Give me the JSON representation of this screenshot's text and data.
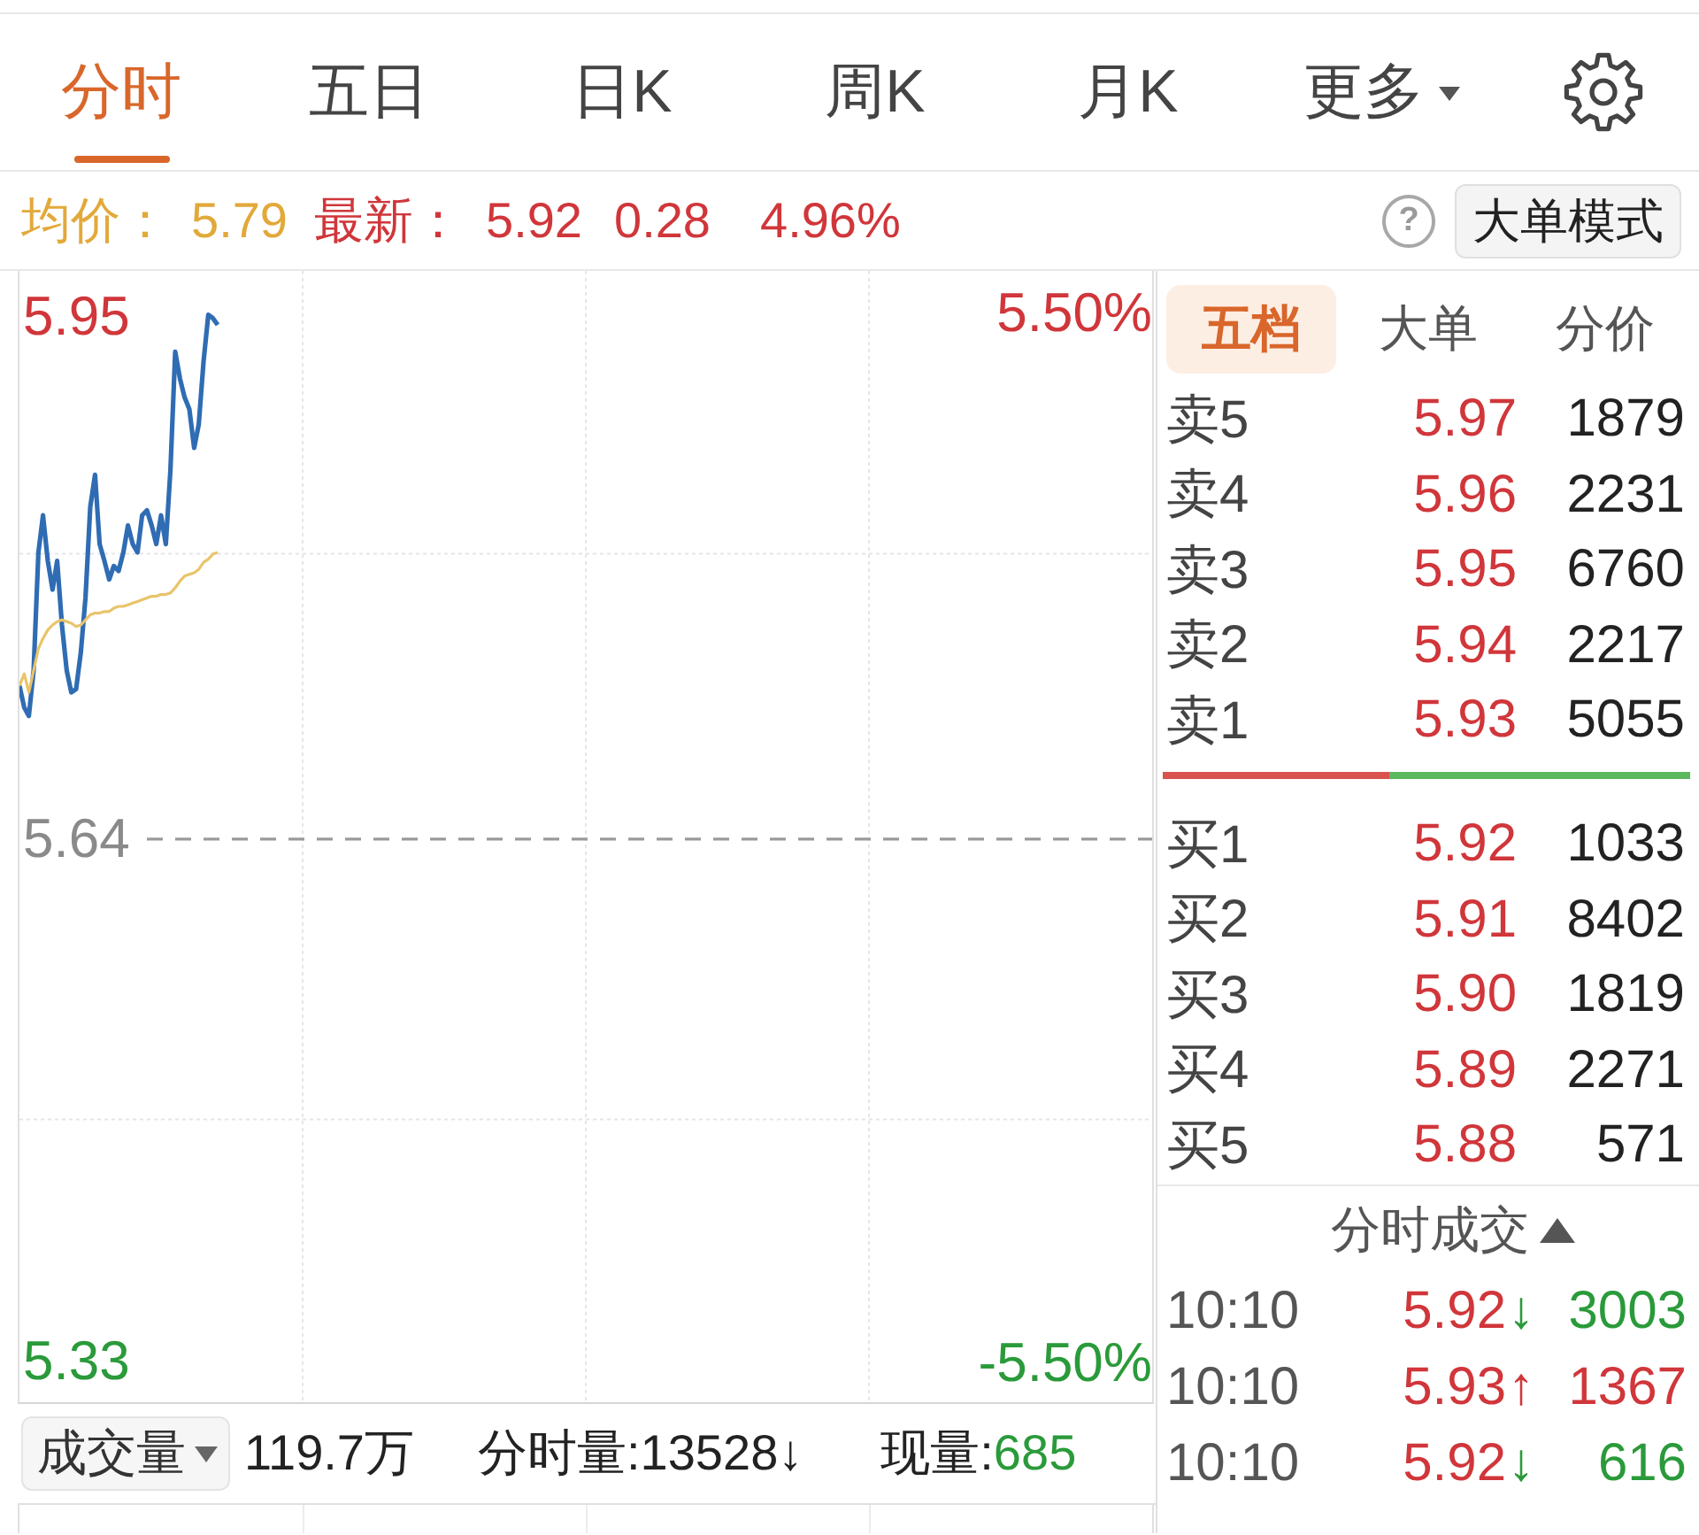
{
  "tabs": [
    {
      "label": "分时",
      "selected": true,
      "kind": "tab"
    },
    {
      "label": "五日",
      "selected": false,
      "kind": "tab"
    },
    {
      "label": "日K",
      "selected": false,
      "kind": "tab"
    },
    {
      "label": "周K",
      "selected": false,
      "kind": "tab"
    },
    {
      "label": "月K",
      "selected": false,
      "kind": "tab"
    },
    {
      "label": "更多",
      "selected": false,
      "kind": "menu"
    }
  ],
  "quote": {
    "average": {
      "label": "均价：",
      "value": "5.79"
    },
    "latest": {
      "label": "最新：",
      "price": "5.92",
      "change": "0.28",
      "change_pct": "4.96%",
      "rising": true
    }
  },
  "help": "?",
  "mode_button": "大单模式",
  "chart": {
    "chart_data": {
      "type": "line",
      "categories": [
        null,
        null,
        null,
        null,
        null,
        null,
        null,
        null,
        null,
        null,
        null,
        null,
        null,
        null,
        null,
        null,
        null,
        null,
        null,
        null,
        null,
        null,
        null,
        null,
        null,
        null,
        null,
        null,
        null,
        null,
        null,
        null,
        null,
        null,
        null,
        null,
        null,
        null,
        null,
        null,
        null,
        null,
        null,
        null,
        null,
        null,
        null,
        null,
        null,
        null,
        null,
        null,
        null,
        null,
        null,
        null,
        null,
        null,
        null,
        null,
        null,
        null,
        null,
        null,
        null,
        null,
        null,
        null,
        null,
        null,
        null,
        null,
        null,
        null,
        null,
        null,
        null,
        null,
        null,
        null,
        null,
        null,
        null,
        null,
        null,
        null,
        null,
        null,
        null,
        null,
        null,
        null,
        null,
        null,
        null,
        null,
        null,
        null,
        null,
        null,
        null,
        null,
        null,
        null,
        null,
        null,
        null,
        null,
        null,
        null,
        null,
        null,
        null,
        null,
        null,
        null,
        null,
        null,
        null,
        null,
        null,
        null,
        null,
        null,
        null,
        null,
        null,
        null,
        null,
        null,
        null,
        null,
        null,
        null,
        null,
        null,
        null,
        null,
        null,
        null,
        null,
        null,
        null,
        null,
        null,
        null,
        null,
        null,
        null,
        null,
        null,
        null,
        null,
        null,
        null,
        null,
        null,
        null,
        null,
        null,
        null,
        null,
        null,
        null,
        null,
        null,
        null,
        null,
        null,
        null,
        null,
        null,
        null,
        null,
        null,
        null,
        null,
        null,
        null,
        null,
        null,
        null,
        null,
        null,
        null,
        null,
        null,
        null,
        null,
        null,
        null,
        null,
        null,
        null,
        null,
        null,
        null,
        null,
        null,
        null,
        null,
        null,
        null,
        null,
        null,
        null,
        null,
        null,
        null,
        null,
        null,
        null,
        null,
        null,
        null,
        null,
        null,
        null,
        null,
        null,
        null,
        null,
        null,
        null,
        null,
        null,
        null,
        null,
        null,
        null,
        null,
        null,
        null,
        null,
        null,
        null,
        null,
        null,
        null,
        null,
        null
      ],
      "ylim": [
        5.306,
        5.977
      ],
      "yticks": [
        {
          "value": 5.95,
          "label": "5.95"
        },
        {
          "value": 5.64,
          "label": "5.64"
        },
        {
          "value": 5.33,
          "label": "5.33"
        }
      ],
      "ref_lines": [
        {
          "axis": "y",
          "value": 5.64
        }
      ],
      "series": [
        {
          "color": "#2f6cb3",
          "values": [
            5.731,
            5.718,
            5.713,
            5.74,
            5.81,
            5.832,
            5.805,
            5.788,
            5.805,
            5.767,
            5.74,
            5.727,
            5.729,
            5.751,
            5.783,
            5.837,
            5.856,
            5.815,
            5.805,
            5.794,
            5.802,
            5.799,
            5.81,
            5.826,
            5.815,
            5.81,
            5.832,
            5.835,
            5.826,
            5.815,
            5.832,
            5.815,
            5.859,
            5.929,
            5.913,
            5.902,
            5.895,
            5.872,
            5.886,
            5.923,
            5.951,
            5.949,
            5.945,
            null,
            null,
            null,
            null,
            null,
            null,
            null,
            null,
            null,
            null,
            null,
            null,
            null,
            null,
            null,
            null,
            null,
            null,
            null,
            null,
            null,
            null,
            null,
            null,
            null,
            null,
            null,
            null,
            null,
            null,
            null,
            null,
            null,
            null,
            null,
            null,
            null,
            null,
            null,
            null,
            null,
            null,
            null,
            null,
            null,
            null,
            null,
            null,
            null,
            null,
            null,
            null,
            null,
            null,
            null,
            null,
            null,
            null,
            null,
            null,
            null,
            null,
            null,
            null,
            null,
            null,
            null,
            null,
            null,
            null,
            null,
            null,
            null,
            null,
            null,
            null,
            null,
            null,
            null,
            null,
            null,
            null,
            null,
            null,
            null,
            null,
            null,
            null,
            null,
            null,
            null,
            null,
            null,
            null,
            null,
            null,
            null,
            null,
            null,
            null,
            null,
            null,
            null,
            null,
            null,
            null,
            null,
            null,
            null,
            null,
            null,
            null,
            null,
            null,
            null,
            null,
            null,
            null,
            null,
            null,
            null,
            null,
            null,
            null,
            null,
            null,
            null,
            null,
            null,
            null,
            null,
            null,
            null,
            null,
            null,
            null,
            null,
            null,
            null,
            null,
            null,
            null,
            null,
            null,
            null,
            null,
            null,
            null,
            null,
            null,
            null,
            null,
            null,
            null,
            null,
            null,
            null,
            null,
            null,
            null,
            null,
            null,
            null,
            null,
            null,
            null,
            null,
            null,
            null,
            null,
            null,
            null,
            null,
            null,
            null,
            null,
            null,
            null,
            null,
            null,
            null,
            null,
            null,
            null,
            null,
            null,
            null,
            null,
            null,
            null,
            null,
            null,
            null,
            null,
            null,
            null,
            null,
            null
          ]
        },
        {
          "color": "#e9c46a",
          "values": [
            5.731,
            5.738,
            5.727,
            5.74,
            5.753,
            5.759,
            5.764,
            5.767,
            5.769,
            5.77,
            5.769,
            5.768,
            5.766,
            5.767,
            5.77,
            5.773,
            5.774,
            5.774,
            5.775,
            5.775,
            5.777,
            5.778,
            5.778,
            5.779,
            5.78,
            5.781,
            5.782,
            5.783,
            5.784,
            5.784,
            5.785,
            5.785,
            5.786,
            5.789,
            5.793,
            5.796,
            5.797,
            5.798,
            5.8,
            5.804,
            5.806,
            5.809,
            5.81,
            null,
            null,
            null,
            null,
            null,
            null,
            null,
            null,
            null,
            null,
            null,
            null,
            null,
            null,
            null,
            null,
            null,
            null,
            null,
            null,
            null,
            null,
            null,
            null,
            null,
            null,
            null,
            null,
            null,
            null,
            null,
            null,
            null,
            null,
            null,
            null,
            null,
            null,
            null,
            null,
            null,
            null,
            null,
            null,
            null,
            null,
            null,
            null,
            null,
            null,
            null,
            null,
            null,
            null,
            null,
            null,
            null,
            null,
            null,
            null,
            null,
            null,
            null,
            null,
            null,
            null,
            null,
            null,
            null,
            null,
            null,
            null,
            null,
            null,
            null,
            null,
            null,
            null,
            null,
            null,
            null,
            null,
            null,
            null,
            null,
            null,
            null,
            null,
            null,
            null,
            null,
            null,
            null,
            null,
            null,
            null,
            null,
            null,
            null,
            null,
            null,
            null,
            null,
            null,
            null,
            null,
            null,
            null,
            null,
            null,
            null,
            null,
            null,
            null,
            null,
            null,
            null,
            null,
            null,
            null,
            null,
            null,
            null,
            null,
            null,
            null,
            null,
            null,
            null,
            null,
            null,
            null,
            null,
            null,
            null,
            null,
            null,
            null,
            null,
            null,
            null,
            null,
            null,
            null,
            null,
            null,
            null,
            null,
            null,
            null,
            null,
            null,
            null,
            null,
            null,
            null,
            null,
            null,
            null,
            null,
            null,
            null,
            null,
            null,
            null,
            null,
            null,
            null,
            null,
            null,
            null,
            null,
            null,
            null,
            null,
            null,
            null,
            null,
            null,
            null,
            null,
            null,
            null,
            null,
            null,
            null,
            null,
            null,
            null,
            null,
            null,
            null,
            null,
            null,
            null,
            null,
            null,
            null
          ]
        }
      ]
    },
    "pct_labels": [
      {
        "text": "5.50%",
        "color": "#d0363a"
      },
      {
        "text": "-5.50%",
        "color": "#2a9a3a"
      }
    ]
  },
  "volume_bar": {
    "selector": "成交量",
    "total": "119.7万",
    "minute": "分时量:13528↓",
    "current_label": "现量:",
    "current_value": "685",
    "rising": false
  },
  "book_tabs": [
    {
      "label": "五档",
      "selected": true
    },
    {
      "label": "大单",
      "selected": false
    },
    {
      "label": "分价",
      "selected": false
    }
  ],
  "asks": [
    {
      "label": "卖5",
      "price": "5.97",
      "volume": "1879"
    },
    {
      "label": "卖4",
      "price": "5.96",
      "volume": "2231"
    },
    {
      "label": "卖3",
      "price": "5.95",
      "volume": "6760"
    },
    {
      "label": "卖2",
      "price": "5.94",
      "volume": "2217"
    },
    {
      "label": "卖1",
      "price": "5.93",
      "volume": "5055"
    }
  ],
  "ratio_bar": {
    "level": 0.43
  },
  "bids": [
    {
      "label": "买1",
      "price": "5.92",
      "volume": "1033"
    },
    {
      "label": "买2",
      "price": "5.91",
      "volume": "8402"
    },
    {
      "label": "买3",
      "price": "5.90",
      "volume": "1819"
    },
    {
      "label": "买4",
      "price": "5.89",
      "volume": "2271"
    },
    {
      "label": "买5",
      "price": "5.88",
      "volume": "571"
    }
  ],
  "trades": {
    "title": "分时成交",
    "rows": [
      {
        "time": "10:10",
        "price": "5.92",
        "arrow": "↓",
        "volume": "3003",
        "color": "#2a9a3a"
      },
      {
        "time": "10:10",
        "price": "5.93",
        "arrow": "↑",
        "volume": "1367",
        "color": "#d0363a"
      },
      {
        "time": "10:10",
        "price": "5.92",
        "arrow": "↓",
        "volume": "616",
        "color": "#2a9a3a"
      }
    ]
  }
}
